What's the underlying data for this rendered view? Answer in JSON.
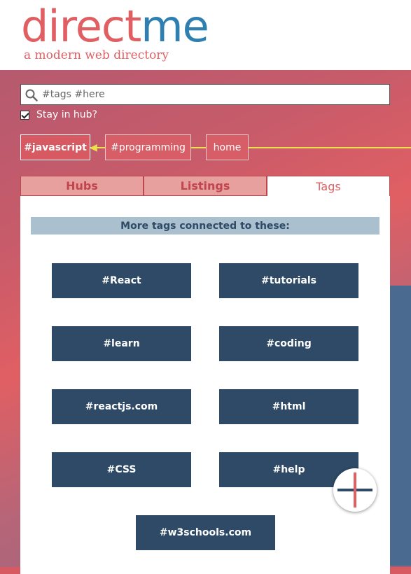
{
  "brand": {
    "logo_part1": "direct",
    "logo_part2": "me",
    "tagline": "a modern web directory",
    "colors": {
      "accent": "#e05f63",
      "secondary": "#2f7fb0",
      "navy": "#2e4a66"
    }
  },
  "search": {
    "placeholder": "#tags #here",
    "value": "",
    "icon": "search-icon"
  },
  "stay_in_hub": {
    "label": "Stay in hub?",
    "checked": true
  },
  "breadcrumb": [
    {
      "label": "#javascript",
      "active": true
    },
    {
      "label": "#programming",
      "active": false
    },
    {
      "label": "home",
      "active": false
    }
  ],
  "tabs": [
    {
      "label": "Hubs",
      "active": false
    },
    {
      "label": "Listings",
      "active": false
    },
    {
      "label": "Tags",
      "active": true
    }
  ],
  "tags_panel": {
    "heading": "More tags connected to these:",
    "tags": [
      "#React",
      "#tutorials",
      "#learn",
      "#coding",
      "#reactjs.com",
      "#html",
      "#CSS",
      "#help",
      "#w3schools.com"
    ]
  },
  "fab": {
    "icon": "add-icon"
  }
}
